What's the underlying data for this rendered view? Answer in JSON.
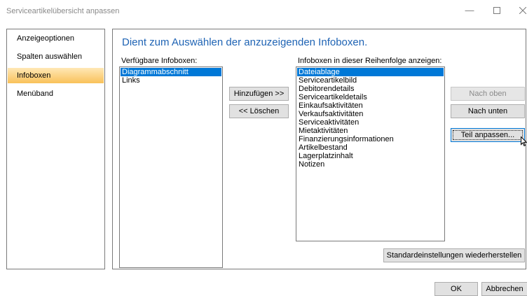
{
  "window": {
    "title": "Serviceartikelübersicht anpassen"
  },
  "nav": {
    "items": [
      {
        "label": "Anzeigeoptionen",
        "active": false
      },
      {
        "label": "Spalten auswählen",
        "active": false
      },
      {
        "label": "Infoboxen",
        "active": true
      },
      {
        "label": "Menüband",
        "active": false
      }
    ]
  },
  "main": {
    "heading": "Dient zum Auswählen der anzuzeigenden Infoboxen.",
    "available": {
      "label": "Verfügbare Infoboxen:",
      "items": [
        "Diagrammabschnitt",
        "Links"
      ],
      "selected_index": 0
    },
    "shown": {
      "label": "Infoboxen in dieser Reihenfolge anzeigen:",
      "items": [
        "Dateiablage",
        "Serviceartikelbild",
        "Debitorendetails",
        "Serviceartikeldetails",
        "Einkaufsaktivitäten",
        "Verkaufsaktivitäten",
        "Serviceaktivitäten",
        "Mietaktivitäten",
        "Finanzierungsinformationen",
        "Artikelbestand",
        "Lagerplatzinhalt",
        "Notizen"
      ],
      "selected_index": 0
    },
    "buttons": {
      "add": "Hinzufügen >>",
      "remove": "<< Löschen",
      "move_up": "Nach oben",
      "move_down": "Nach unten",
      "customize": "Teil anpassen...",
      "restore_defaults": "Standardeinstellungen wiederherstellen"
    }
  },
  "footer": {
    "ok": "OK",
    "cancel": "Abbrechen"
  },
  "colors": {
    "accent": "#0078d7",
    "heading": "#1e63b4",
    "nav_active_top": "#ffe8b6",
    "nav_active_bottom": "#f9c15a"
  },
  "icons": {
    "minimize": "minimize-icon",
    "maximize": "maximize-icon",
    "close": "close-icon",
    "cursor": "mouse-pointer-icon"
  }
}
